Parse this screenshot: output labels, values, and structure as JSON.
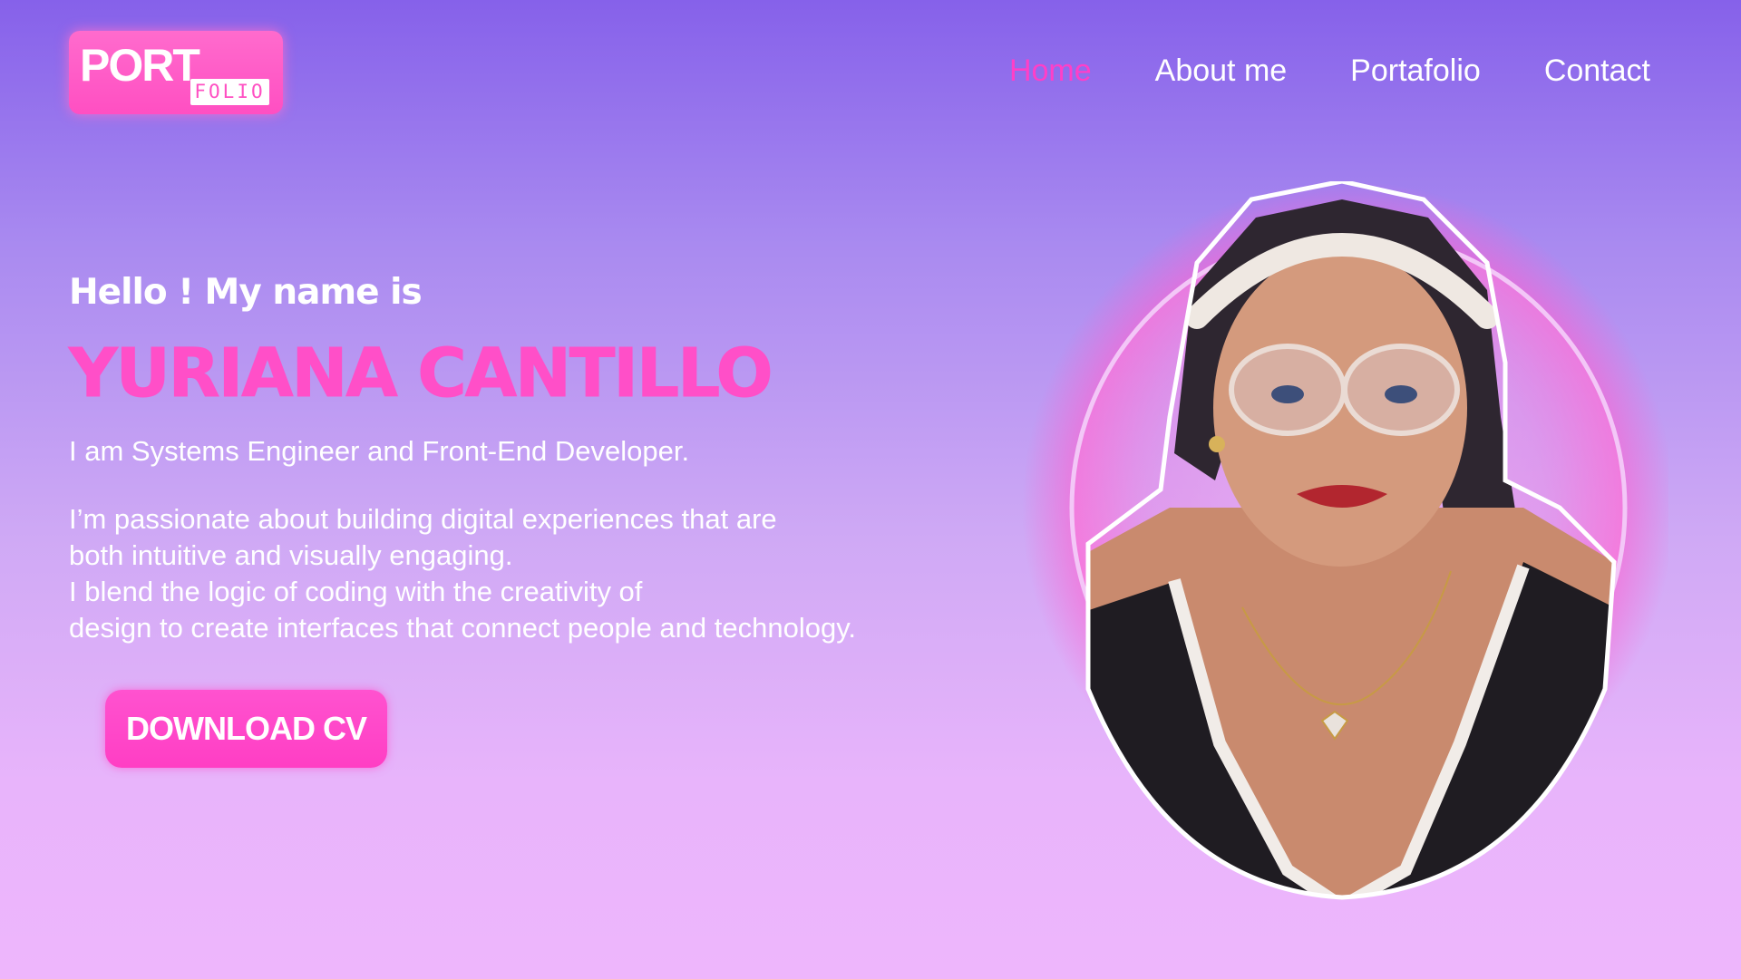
{
  "logo": {
    "part1": "PORT",
    "part2": "FOLIO"
  },
  "nav": {
    "items": [
      {
        "label": "Home",
        "active": true
      },
      {
        "label": "About me",
        "active": false
      },
      {
        "label": "Portafolio",
        "active": false
      },
      {
        "label": "Contact",
        "active": false
      }
    ]
  },
  "hero": {
    "greeting": "Hello ! My name is",
    "name": "YURIANA CANTILLO",
    "role": "I am Systems Engineer and Front-End Developer.",
    "bio_lines": [
      "I’m passionate about building digital experiences that are",
      "both intuitive and visually engaging.",
      "I blend the logic of coding with the creativity of",
      "design to create interfaces that connect people and technology."
    ],
    "cta_label": "DOWNLOAD CV"
  },
  "colors": {
    "accent": "#ff4fc8",
    "active_nav": "#ff3fc8",
    "bg_top": "#8661ea",
    "bg_bottom": "#eeb6fc"
  }
}
